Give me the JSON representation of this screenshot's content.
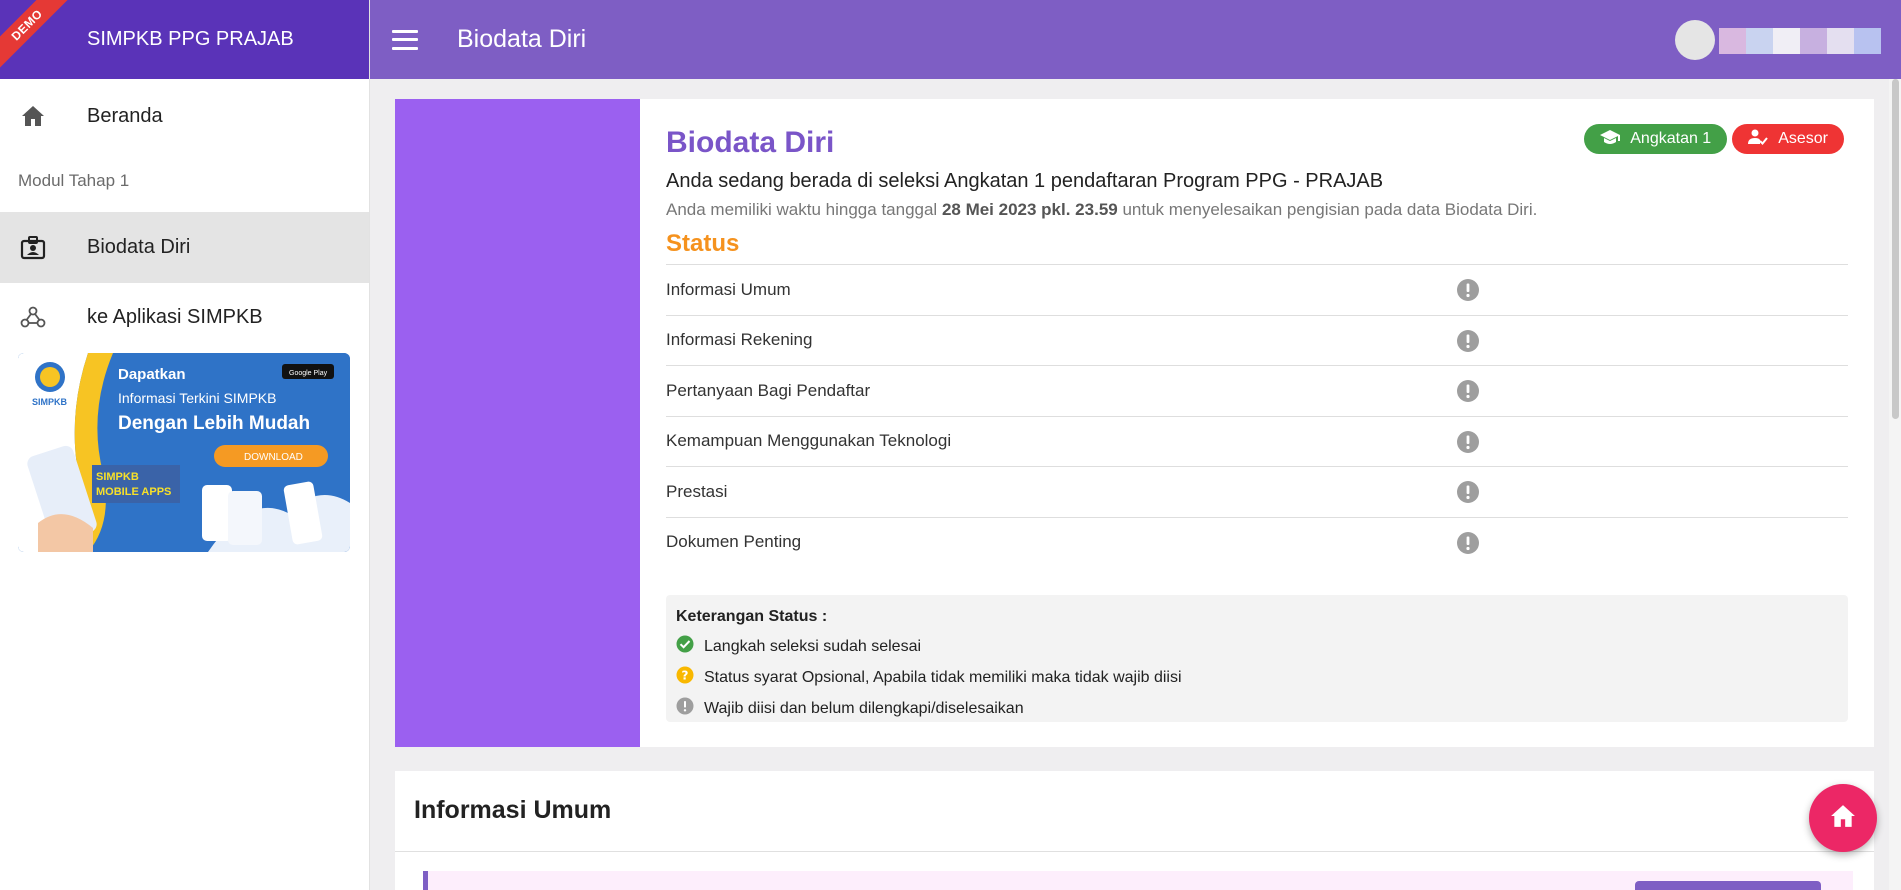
{
  "app": {
    "brand": "SIMPKB PPG PRAJAB",
    "ribbon": "DEMO",
    "page_title": "Biodata Diri"
  },
  "sidebar": {
    "items": [
      {
        "label": "Beranda",
        "icon": "home-icon"
      },
      {
        "label": "Biodata Diri",
        "icon": "id-badge-icon",
        "active": true
      },
      {
        "label": "ke Aplikasi SIMPKB",
        "icon": "webhook-icon"
      }
    ],
    "section_label": "Modul Tahap 1",
    "promo": {
      "headline": "Dapatkan",
      "line1": "Informasi Terkini SIMPKB",
      "line2": "Dengan Lebih Mudah",
      "button": "DOWNLOAD",
      "apps_label_1": "SIMPKB",
      "apps_label_2": "MOBILE APPS",
      "logo_text": "SIMPKB",
      "store": "Google Play"
    }
  },
  "main": {
    "title": "Biodata Diri",
    "badges": [
      {
        "label": "Angkatan 1",
        "icon": "graduation-cap-icon",
        "color": "#43a047"
      },
      {
        "label": "Asesor",
        "icon": "user-check-icon",
        "color": "#ef3434"
      }
    ],
    "subtitle": "Anda sedang berada di seleksi Angkatan 1 pendaftaran Program PPG - PRAJAB",
    "note_prefix": "Anda memiliki waktu hingga tanggal ",
    "note_deadline": "28 Mei 2023 pkl. 23.59",
    "note_suffix": " untuk menyelesaikan pengisian pada data Biodata Diri.",
    "status_heading": "Status",
    "status_items": [
      {
        "label": "Informasi Umum",
        "state": "required"
      },
      {
        "label": "Informasi Rekening",
        "state": "required"
      },
      {
        "label": "Pertanyaan Bagi Pendaftar",
        "state": "required"
      },
      {
        "label": "Kemampuan Menggunakan Teknologi",
        "state": "required"
      },
      {
        "label": "Prestasi",
        "state": "required"
      },
      {
        "label": "Dokumen Penting",
        "state": "required"
      }
    ],
    "legend": {
      "title": "Keterangan Status :",
      "items": [
        {
          "label": "Langkah seleksi sudah selesai",
          "icon": "check-circle-icon",
          "color": "#43a047"
        },
        {
          "label": "Status syarat Opsional, Apabila tidak memiliki maka tidak wajib diisi",
          "icon": "question-circle-icon",
          "color": "#f9b800"
        },
        {
          "label": "Wajib diisi dan belum dilengkapi/diselesaikan",
          "icon": "exclamation-circle-icon",
          "color": "#9e9e9e"
        }
      ]
    }
  },
  "section2": {
    "title": "Informasi Umum"
  },
  "colors": {
    "brand": "#5a33b8",
    "topbar": "#7e5ec4",
    "accent_side": "#9b60f0",
    "status_heading": "#f5921e",
    "fab": "#ec2766"
  }
}
